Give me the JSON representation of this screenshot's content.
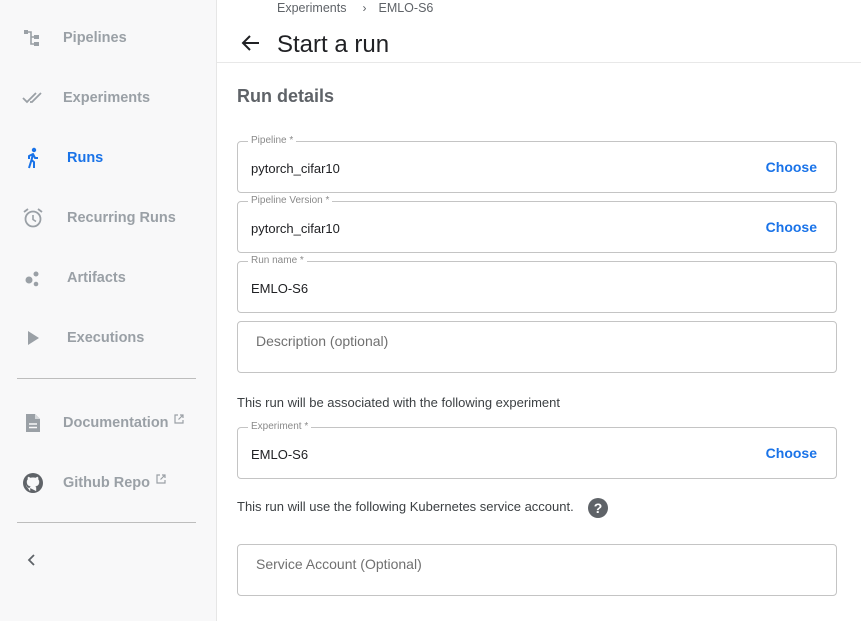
{
  "sidebar": {
    "items": [
      {
        "label": "Pipelines",
        "icon": "pipelines-icon",
        "active": false
      },
      {
        "label": "Experiments",
        "icon": "double-check-icon",
        "active": false
      },
      {
        "label": "Runs",
        "icon": "running-person-icon",
        "active": true
      },
      {
        "label": "Recurring Runs",
        "icon": "alarm-clock-icon",
        "active": false
      },
      {
        "label": "Artifacts",
        "icon": "bubbles-icon",
        "active": false
      },
      {
        "label": "Executions",
        "icon": "play-icon",
        "active": false
      }
    ],
    "links": [
      {
        "label": "Documentation",
        "icon": "document-icon"
      },
      {
        "label": "Github Repo",
        "icon": "github-icon"
      }
    ],
    "collapse_icon": "chevron-left-icon"
  },
  "header": {
    "breadcrumb": [
      "Experiments",
      "EMLO-S6"
    ],
    "breadcrumb_separator": "›",
    "title": "Start a run"
  },
  "main": {
    "section_title": "Run details",
    "pipeline": {
      "label": "Pipeline *",
      "value": "pytorch_cifar10",
      "action": "Choose"
    },
    "pipeline_version": {
      "label": "Pipeline Version *",
      "value": "pytorch_cifar10",
      "action": "Choose"
    },
    "run_name": {
      "label": "Run name *",
      "value": "EMLO-S6"
    },
    "description": {
      "placeholder": "Description (optional)"
    },
    "experiment_note": "This run will be associated with the following experiment",
    "experiment": {
      "label": "Experiment *",
      "value": "EMLO-S6",
      "action": "Choose"
    },
    "service_account_note": "This run will use the following Kubernetes service account.",
    "help_icon": "?",
    "service_account": {
      "placeholder": "Service Account (Optional)"
    }
  },
  "colors": {
    "accent": "#1a73e8",
    "muted": "#9aa0a6",
    "sidebar_bg": "#f8f8f9"
  }
}
